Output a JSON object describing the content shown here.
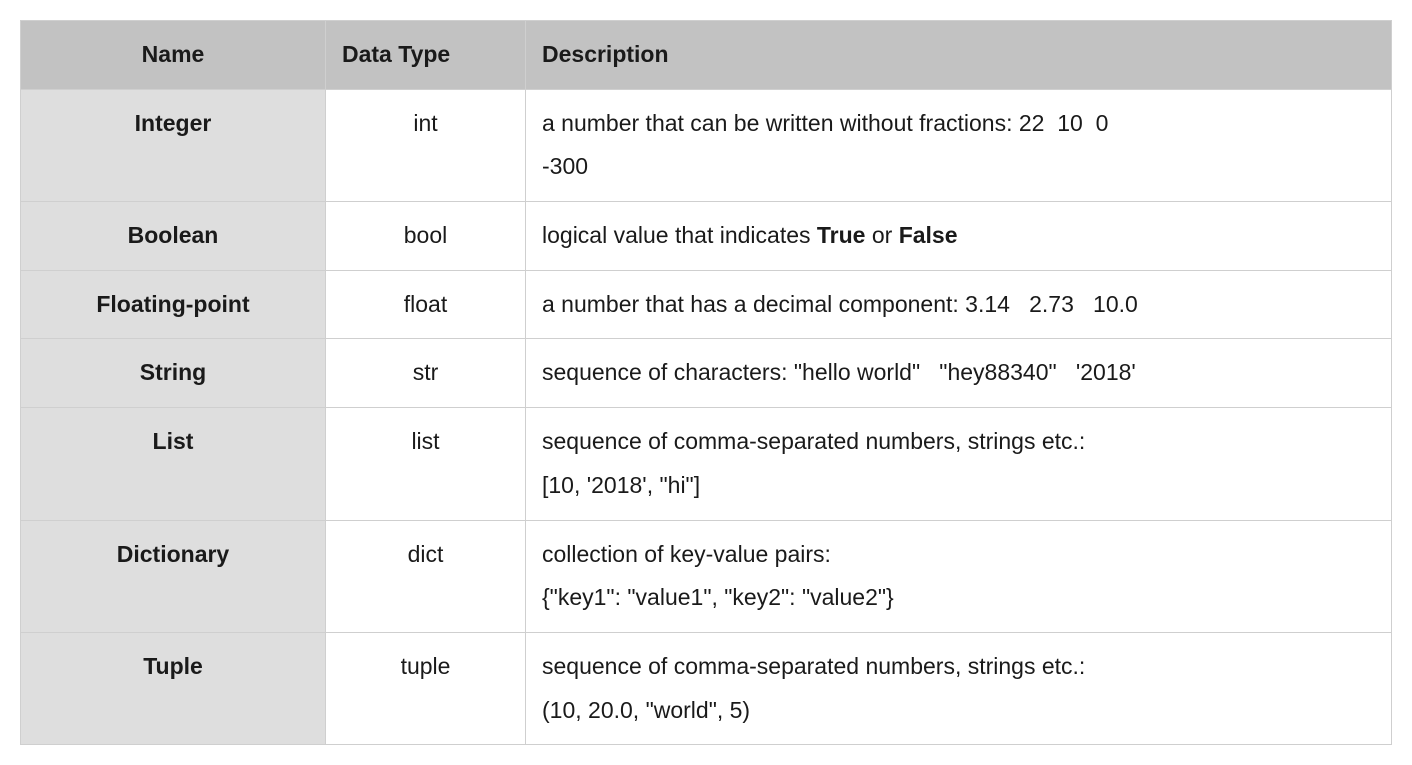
{
  "headers": {
    "name": "Name",
    "type": "Data Type",
    "desc": "Description"
  },
  "rows": [
    {
      "name": "Integer",
      "type": "int",
      "desc_html": "a number that can be written without fractions: 22&nbsp;&nbsp;10&nbsp;&nbsp;0&nbsp;&nbsp;<br>-300"
    },
    {
      "name": "Boolean",
      "type": "bool",
      "desc_html": "logical value that indicates <span class=\"b\">True</span> or <span class=\"b\">False</span>"
    },
    {
      "name": "Floating-point",
      "type": "float",
      "desc_html": "a number that has a decimal component: 3.14&nbsp;&nbsp;&nbsp;2.73&nbsp;&nbsp;&nbsp;10.0"
    },
    {
      "name": "String",
      "type": "str",
      "desc_html": "sequence of characters: \"hello world\"&nbsp;&nbsp;&nbsp;\"hey88340\"&nbsp;&nbsp;&nbsp;'2018'"
    },
    {
      "name": "List",
      "type": "list",
      "desc_html": "sequence of comma-separated numbers, strings etc.:<br>[10, '2018', \"hi\"]"
    },
    {
      "name": "Dictionary",
      "type": "dict",
      "desc_html": "collection of key-value pairs:<br>{\"key1\": \"value1\", \"key2\": \"value2\"}"
    },
    {
      "name": "Tuple",
      "type": "tuple",
      "desc_html": "sequence of comma-separated numbers, strings etc.:<br>(10, 20.0, \"world\", 5)"
    }
  ]
}
